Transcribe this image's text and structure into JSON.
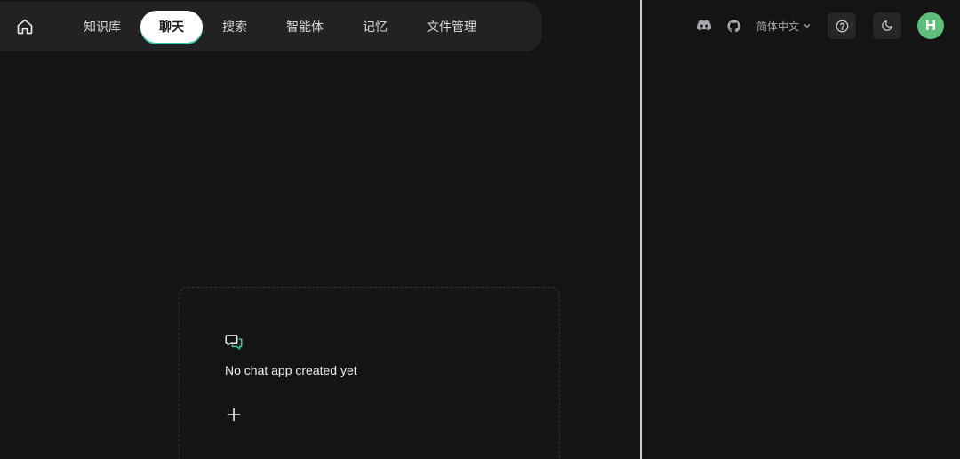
{
  "nav": {
    "home_icon": "home-icon",
    "items": [
      {
        "label": "知识库",
        "active": false
      },
      {
        "label": "聊天",
        "active": true
      },
      {
        "label": "搜索",
        "active": false
      },
      {
        "label": "智能体",
        "active": false
      },
      {
        "label": "记忆",
        "active": false
      },
      {
        "label": "文件管理",
        "active": false
      }
    ]
  },
  "header": {
    "discord_icon": "discord-icon",
    "github_icon": "github-icon",
    "language": "简体中文",
    "help_icon": "help-circle-icon",
    "theme_icon": "moon-icon",
    "avatar_initial": "H"
  },
  "empty_state": {
    "icon": "chat-bubbles-icon",
    "message": "No chat app created yet",
    "add_icon": "plus-icon"
  },
  "colors": {
    "background": "#141415",
    "nav_background": "#222224",
    "accent": "#3fc4a7",
    "avatar": "#5ebd7a"
  }
}
